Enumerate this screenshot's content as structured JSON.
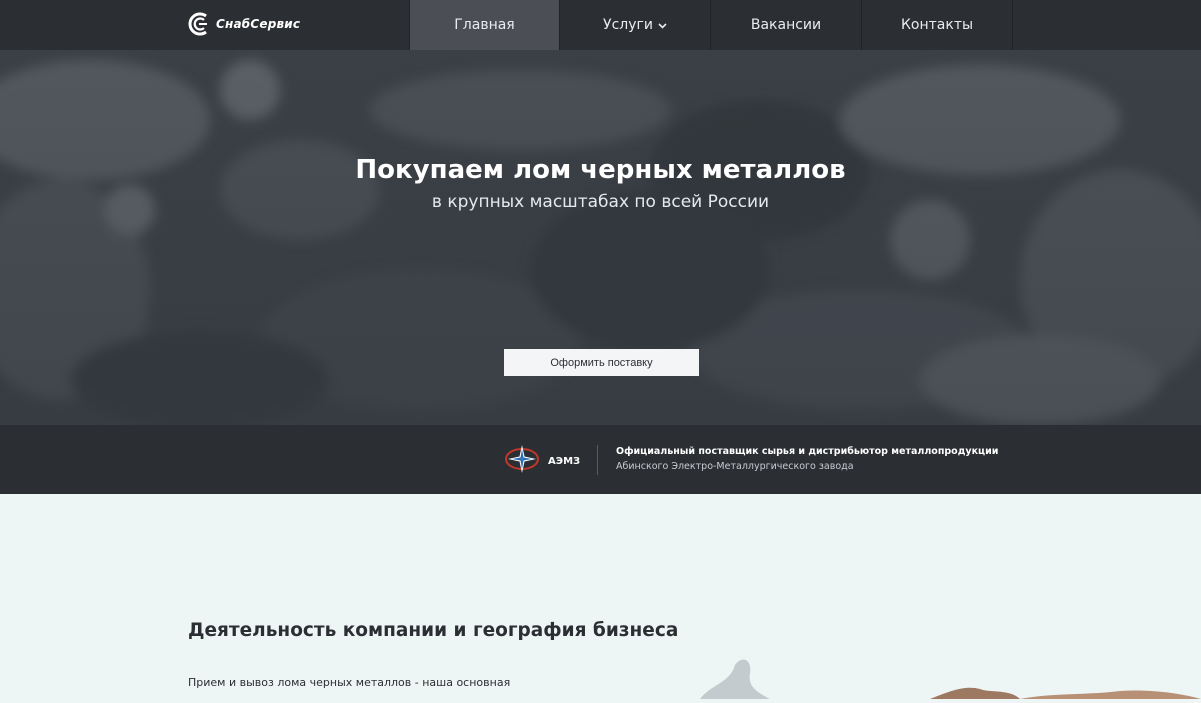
{
  "brand": {
    "name": "СнабСервис"
  },
  "nav": {
    "items": [
      {
        "label": "Главная",
        "active": true
      },
      {
        "label": "Услуги",
        "has_dropdown": true
      },
      {
        "label": "Вакансии"
      },
      {
        "label": "Контакты"
      }
    ]
  },
  "hero": {
    "title": "Покупаем лом черных металлов",
    "subtitle": "в крупных масштабах по всей России",
    "cta_label": "Оформить поставку"
  },
  "partner": {
    "logo_abbr": "АЭМЗ",
    "line1": "Официальный поставщик сырья и дистрибьютор металлопродукции",
    "line2": "Абинского Электро-Металлургического завода"
  },
  "about": {
    "title": "Деятельность компании и география бизнеса",
    "text": "Прием и вывоз лома черных металлов - наша основная"
  },
  "colors": {
    "nav_bg": "#2b2e33",
    "nav_active": "#4b4f55",
    "page_bg": "#eef6f5",
    "button_bg": "#f4f5f6"
  },
  "icons": {
    "brand": "snabservis-logo-icon",
    "dropdown": "chevron-down-icon",
    "partner": "aemz-compass-icon"
  }
}
